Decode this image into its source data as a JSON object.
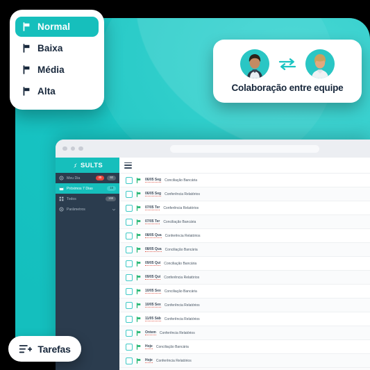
{
  "priority_card": {
    "name": "priority-selector",
    "items": [
      {
        "label": "Normal",
        "icon": "flag-icon",
        "active": true
      },
      {
        "label": "Baixa",
        "icon": "flag-icon",
        "active": false
      },
      {
        "label": "Média",
        "icon": "flag-icon",
        "active": false
      },
      {
        "label": "Alta",
        "icon": "flag-icon",
        "active": false
      }
    ]
  },
  "collaboration_card": {
    "label": "Colaboração entre equipe",
    "swap_icon": "swap-arrows-icon",
    "avatars": [
      "avatar-male",
      "avatar-female"
    ]
  },
  "window": {
    "titlebar": {
      "dots": 3,
      "urlbar_value": ""
    },
    "brand": {
      "text": "SULTS",
      "mark": "sults-logo-icon"
    },
    "sidebar": {
      "items": [
        {
          "label": "Meu Dia",
          "icon": "gear-icon",
          "badges": [
            "45",
            "60"
          ],
          "active": false
        },
        {
          "label": "Próximos 7 Dias",
          "icon": "calendar-icon",
          "badges": [
            "15"
          ],
          "active": true
        },
        {
          "label": "Todos",
          "icon": "grid-icon",
          "badges": [
            "168"
          ],
          "active": false
        },
        {
          "label": "Parâmetros",
          "icon": "gear-icon",
          "badges": [],
          "active": false,
          "chevron": "chevron-down-icon"
        }
      ]
    },
    "topbar": {
      "menu_icon": "hamburger-menu-icon"
    },
    "tasks": [
      {
        "date": "06/05 Seg",
        "title": "Conciliação Bancária"
      },
      {
        "date": "06/05 Seg",
        "title": "Conferência Relatórios"
      },
      {
        "date": "07/05 Ter",
        "title": "Conferência Relatórios"
      },
      {
        "date": "07/05 Ter",
        "title": "Conciliação Bancária"
      },
      {
        "date": "08/05 Qua",
        "title": "Conferência Relatórios"
      },
      {
        "date": "08/05 Qua",
        "title": "Conciliação Bancária"
      },
      {
        "date": "09/05 Qui",
        "title": "Conciliação Bancária"
      },
      {
        "date": "09/05 Qui",
        "title": "Conferência Relatórios"
      },
      {
        "date": "10/05 Sex",
        "title": "Conciliação Bancária"
      },
      {
        "date": "10/05 Sex",
        "title": "Conferência Relatórios"
      },
      {
        "date": "11/05 Sáb",
        "title": "Conferência Relatórios"
      },
      {
        "date": "Ontem",
        "title": "Conferência Relatórios"
      },
      {
        "date": "Hoje",
        "title": "Conciliação Bancária"
      },
      {
        "date": "Hoje",
        "title": "Conferência Relatórios"
      }
    ]
  },
  "tarefas_button": {
    "label": "Tarefas",
    "icon": "list-add-icon"
  },
  "colors": {
    "teal": "#16bfbc",
    "teal_light": "#2ad3d0",
    "dark_navy": "#2b3c4e",
    "text_navy": "#16263a",
    "badge_red": "#e8453c",
    "flag_green": "#19b36b"
  }
}
